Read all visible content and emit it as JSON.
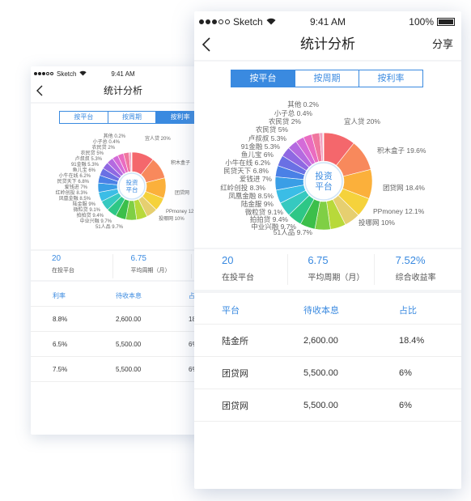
{
  "front": {
    "status": {
      "carrier": "Sketch",
      "time": "9:41 AM",
      "battery": "100%",
      "battery_level": 1.0
    },
    "nav": {
      "title": "统计分析",
      "action": "分享"
    },
    "tabs": [
      {
        "label": "按平台",
        "active": true
      },
      {
        "label": "按周期",
        "active": false
      },
      {
        "label": "按利率",
        "active": false
      }
    ],
    "chart_center": [
      "投资",
      "平台"
    ],
    "stats": [
      {
        "value": "20",
        "label": "在投平台"
      },
      {
        "value": "6.75",
        "label": "平均周期（月）"
      },
      {
        "value": "7.52%",
        "label": "综合收益率"
      }
    ],
    "table": {
      "headers": [
        "平台",
        "待收本息",
        "占比"
      ],
      "rows": [
        [
          "陆金所",
          "2,600.00",
          "18.4%"
        ],
        [
          "团贷网",
          "5,500.00",
          "6%"
        ],
        [
          "团贷网",
          "5,500.00",
          "6%"
        ]
      ]
    }
  },
  "back": {
    "status": {
      "carrier": "Sketch",
      "time": "9:41 AM"
    },
    "nav": {
      "title": "统计分析"
    },
    "tabs": [
      {
        "label": "按平台",
        "active": false
      },
      {
        "label": "按周期",
        "active": false
      },
      {
        "label": "按利率",
        "active": true
      }
    ],
    "chart_center": [
      "投资",
      "平台"
    ],
    "stats": [
      {
        "value": "20",
        "label": "在投平台"
      },
      {
        "value": "6.75",
        "label": "平均周期（月）"
      },
      {
        "value": "7.",
        "label": "综"
      }
    ],
    "table": {
      "headers": [
        "利率",
        "待收本息",
        "占比"
      ],
      "rows": [
        [
          "8.8%",
          "2,600.00",
          "18"
        ],
        [
          "6.5%",
          "5,500.00",
          "6%"
        ],
        [
          "7.5%",
          "5,500.00",
          "6%"
        ]
      ]
    },
    "chart_labels": [
      "其他 0.2%",
      "小子总 0.4%",
      "农民贷 2%",
      "农民贷 5%",
      "卢叔叔 5.3%",
      "91金融 5.3%",
      "鱼儿宝 6%",
      "小牛在线 6.2%",
      "民贷天下 6.8%",
      "爱钱进 7%",
      "红岭创投 8.3%",
      "凤凰金融 8.5%",
      "陆金服 9%",
      "微粒贷 9.1%",
      "拍拍贷 9.4%",
      "中业兴融 9.7%",
      "51人品 9.7%",
      "宜人贷 20%",
      "积木盒子",
      "团贷网",
      "PPmoney 12",
      "投哪网 10%"
    ]
  },
  "chart_data": {
    "type": "pie",
    "donut": true,
    "categories": [
      "宜人贷",
      "积木盒子",
      "团贷网",
      "PPmoney",
      "投哪网",
      "51人品",
      "中业兴融",
      "拍拍贷",
      "微粒贷",
      "陆金服",
      "凤凰金融",
      "红岭创投",
      "爱钱进",
      "民贷天下",
      "小牛在线",
      "鱼儿宝",
      "91金融",
      "卢叔叔",
      "农民贷",
      "农民贷",
      "小子总",
      "其他"
    ],
    "values": [
      20,
      19.6,
      18.4,
      12.1,
      10,
      9.7,
      9.7,
      9.4,
      9.1,
      9,
      8.5,
      8.3,
      7,
      6.8,
      6.2,
      6,
      5.3,
      5.3,
      5,
      2,
      0.4,
      0.2
    ],
    "labels": [
      "宜人贷 20%",
      "积木盒子 19.6%",
      "团贷网 18.4%",
      "PPmoney 12.1%",
      "投哪网 10%",
      "51人品 9.7%",
      "中业兴融 9.7%",
      "拍拍贷 9.4%",
      "微粒贷 9.1%",
      "陆金服 9%",
      "凤凰金融 8.5%",
      "红岭创投 8.3%",
      "爱钱进 7%",
      "民贷天下 6.8%",
      "小牛在线 6.2%",
      "鱼儿宝 6%",
      "91金融 5.3%",
      "卢叔叔 5.3%",
      "农民贷 5%",
      "农民贷 2%",
      "小子总 0.4%",
      "其他 0.2%"
    ],
    "colors": [
      "#f4676c",
      "#f8895c",
      "#fbb03b",
      "#f5d23c",
      "#e6cf70",
      "#b8d93a",
      "#7fcf45",
      "#3cbf4a",
      "#2ec786",
      "#36c9c0",
      "#3bbde6",
      "#3a9ee6",
      "#4a80e6",
      "#6a70e4",
      "#8f68e2",
      "#b46ae0",
      "#d46bd8",
      "#ea6cc0",
      "#f0779e",
      "#f2a0c0",
      "#d0d6e0",
      "#b0b8c6"
    ]
  }
}
